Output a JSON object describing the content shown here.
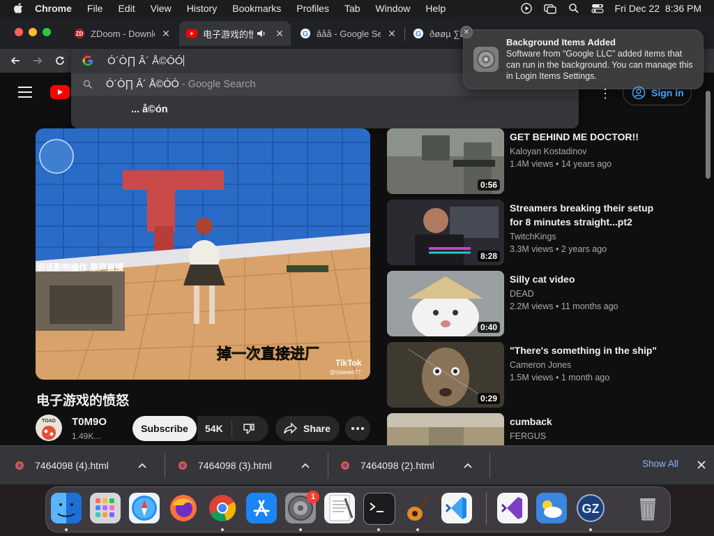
{
  "menubar": {
    "app": "Chrome",
    "items": [
      "File",
      "Edit",
      "View",
      "History",
      "Bookmarks",
      "Profiles",
      "Tab",
      "Window",
      "Help"
    ],
    "clock": "Fri Dec 22  8:36 PM"
  },
  "tabs": [
    {
      "title": "ZDoom - Downlo"
    },
    {
      "title": "电子游戏的愤"
    },
    {
      "title": "âåå - Google Sea"
    },
    {
      "title": "ðøøµ ∑ã"
    }
  ],
  "omnibox": {
    "query": "Ó´Ò∏ Â´ Å©ÓÓ",
    "suggestion_main": "Ó´Ò∏ Â´ Å©ÓÓ",
    "suggestion_suffix": " - Google Search",
    "suggestion_2": "... å©ón"
  },
  "notification": {
    "title": "Background Items Added",
    "body": "Software from “Google LLC” added items that can run in the background. You can manage this in Login Items Settings."
  },
  "youtube": {
    "signin": "Sign in",
    "video_title": "电子游戏的愤怒",
    "channel_name": "T0M9O",
    "channel_subs": "1.49K...",
    "avatar_text": "TOAD",
    "subscribe": "Subscribe",
    "likes": "54K",
    "share": "Share",
    "player_overlay": {
      "caption_left": "讲话影响操作 原声直播",
      "caption_bottom": "掉一次直接进厂",
      "watermark": "TikTok",
      "handle": "@ctseven77"
    }
  },
  "recommendations": [
    {
      "title": "GET BEHIND ME DOCTOR!!",
      "channel": "Kaloyan Kostadinov",
      "meta": "1.4M views • 14 years ago",
      "duration": "0:56"
    },
    {
      "title": "Streamers breaking their setup for 8 minutes straight...pt2",
      "channel": "TwitchKings",
      "meta": "3.3M views • 2 years ago",
      "duration": "8:28"
    },
    {
      "title": "Silly cat video",
      "channel": "DEAD",
      "meta": "2.2M views • 11 months ago",
      "duration": "0:40"
    },
    {
      "title": "\"There's something in the ship\"",
      "channel": "Cameron Jones",
      "meta": "1.5M views • 1 month ago",
      "duration": "0:29"
    },
    {
      "title": "cumback",
      "channel": "FERGUS",
      "meta": "",
      "duration": ""
    }
  ],
  "downloads": [
    {
      "name": "7464098 (4).html"
    },
    {
      "name": "7464098 (3).html"
    },
    {
      "name": "7464098 (2).html"
    }
  ],
  "downloads_show_all": "Show All",
  "dock": {
    "apps": [
      "Finder",
      "Launchpad",
      "Safari",
      "Firefox",
      "Chrome",
      "App Store",
      "System Settings",
      "TextEdit",
      "Terminal",
      "GarageBand",
      "Visual Studio Code",
      "Visual Studio",
      "Weather",
      "GZDoom",
      "Trash"
    ],
    "settings_badge": "1"
  },
  "colors": {
    "yt_red": "#ff0000",
    "link_blue": "#3ea6ff",
    "chrome_dark": "#35363a"
  }
}
